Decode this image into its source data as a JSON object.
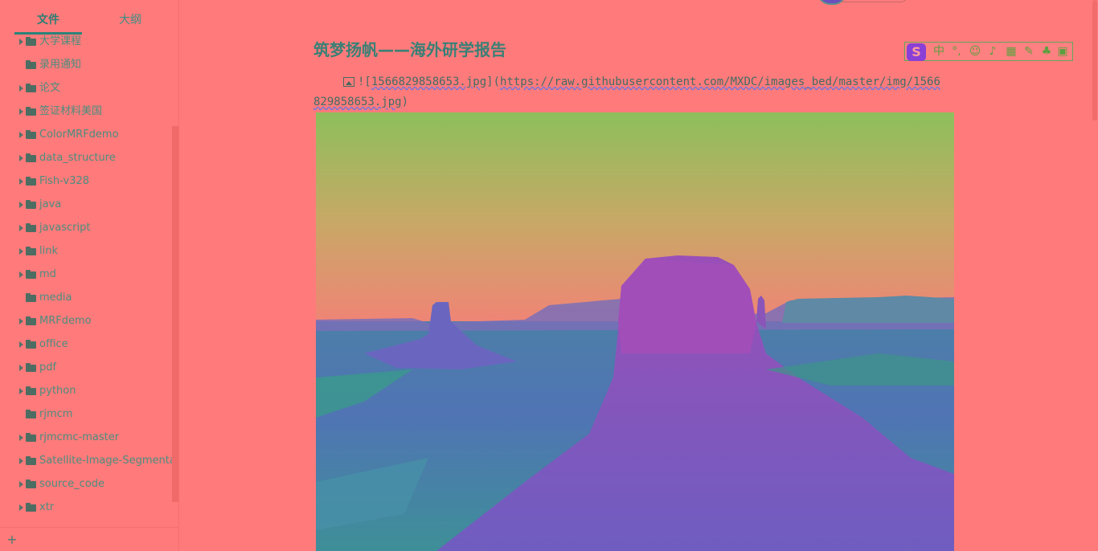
{
  "sidebar": {
    "tabs": [
      {
        "label": "文件"
      },
      {
        "label": "大纲"
      }
    ],
    "items": [
      {
        "label": "大学课程",
        "has_children": true
      },
      {
        "label": "录用通知",
        "has_children": false
      },
      {
        "label": "论文",
        "has_children": true
      },
      {
        "label": "签证材料美国",
        "has_children": true
      },
      {
        "label": "ColorMRFdemo",
        "has_children": true
      },
      {
        "label": "data_structure",
        "has_children": true
      },
      {
        "label": "Fish-v328",
        "has_children": true
      },
      {
        "label": "java",
        "has_children": true
      },
      {
        "label": "javascript",
        "has_children": true
      },
      {
        "label": "link",
        "has_children": true
      },
      {
        "label": "md",
        "has_children": true
      },
      {
        "label": "media",
        "has_children": false
      },
      {
        "label": "MRFdemo",
        "has_children": true
      },
      {
        "label": "office",
        "has_children": true
      },
      {
        "label": "pdf",
        "has_children": true
      },
      {
        "label": "python",
        "has_children": true
      },
      {
        "label": "rjmcm",
        "has_children": false
      },
      {
        "label": "rjmcmc-master",
        "has_children": true
      },
      {
        "label": "Satellite-Image-Segmentat",
        "has_children": true
      },
      {
        "label": "source_code",
        "has_children": true
      },
      {
        "label": "xtr",
        "has_children": true
      }
    ],
    "add_icon": "plus-icon"
  },
  "editor": {
    "title": "筑梦扬帆——海外研学报告",
    "image_markdown": {
      "line1_prefix": "![",
      "alt": "1566829858653.jpg",
      "line1_mid": "](",
      "url_part1": "https://raw.githubusercontent.com/MXDC/images_bed/master/img/1566",
      "url_part2": "829858653.jpg",
      "line2_suffix": ")"
    },
    "image_icon": "image-icon",
    "picture_subject": "desert-mesa-photo"
  },
  "ime_toolbar": {
    "logo": "S",
    "lang": "中",
    "punct": "°,",
    "icons": [
      "emoji-icon",
      "mic-icon",
      "keyboard-icon",
      "handwriting-icon",
      "skin-icon",
      "apps-icon"
    ]
  },
  "colors": {
    "background": "#ff7b7b",
    "accent": "#2b8379",
    "text": "#4a8e7f",
    "ime_logo": "#8a3fd6"
  }
}
